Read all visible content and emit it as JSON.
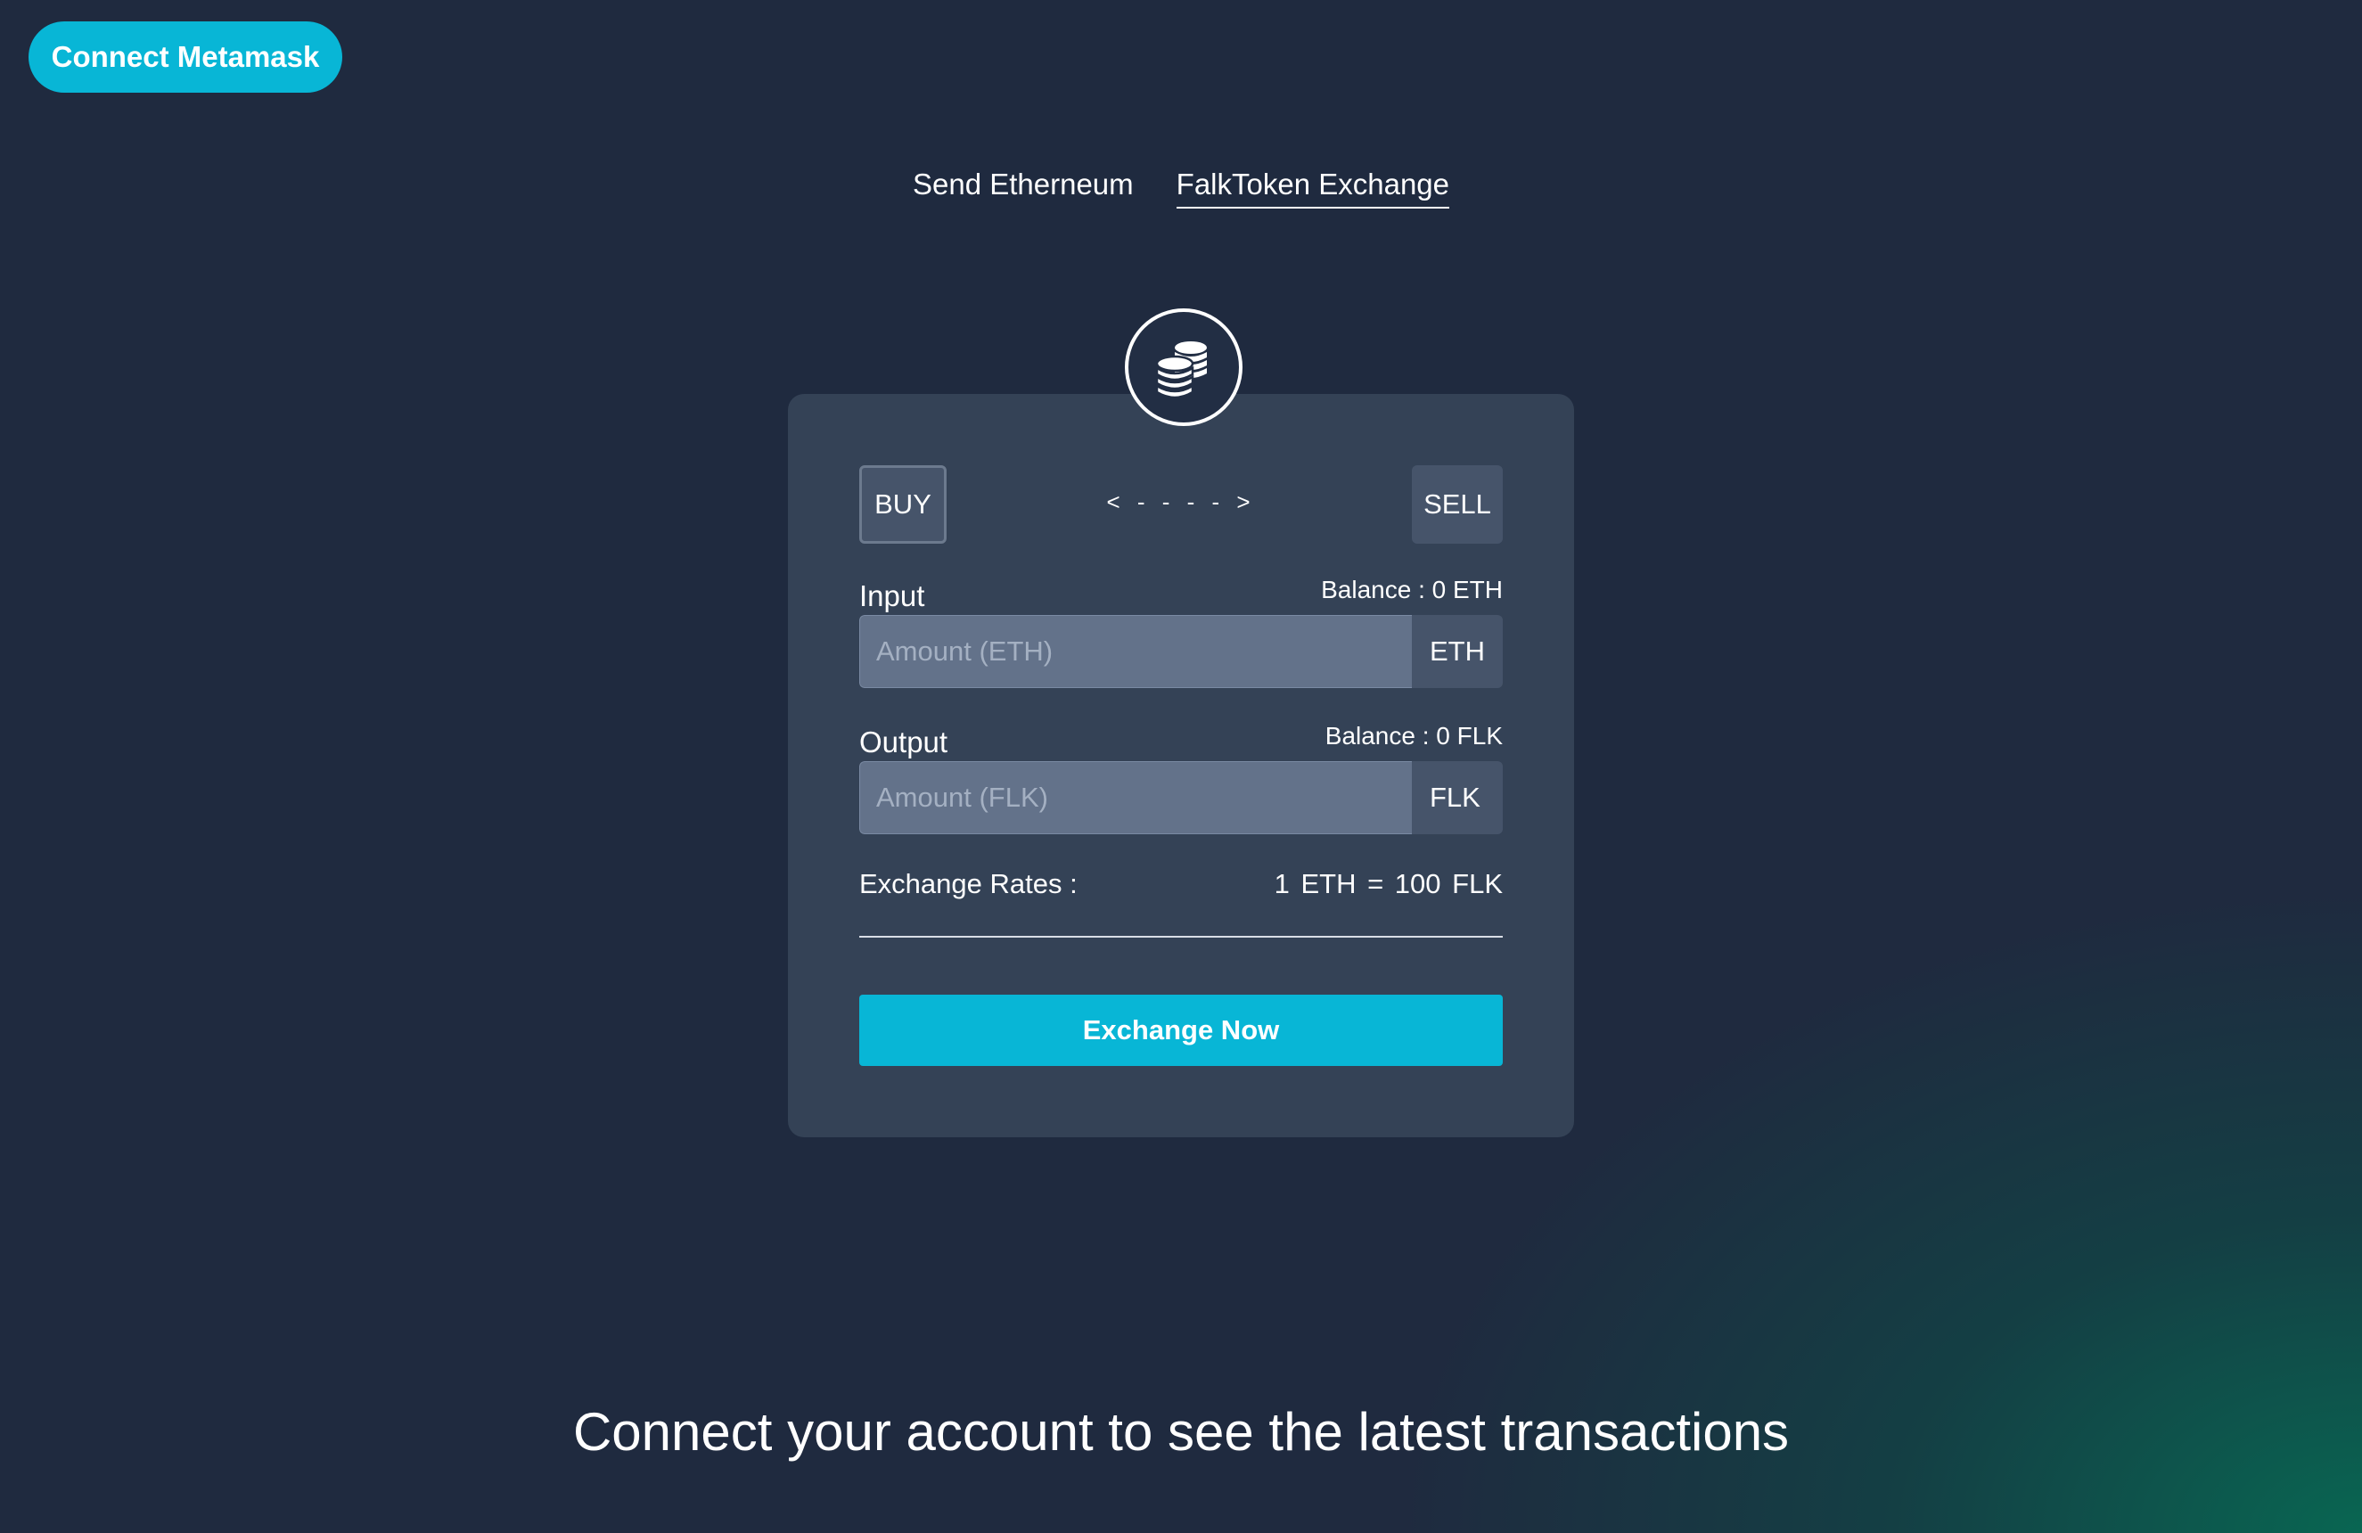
{
  "header": {
    "connect_button_label": "Connect Metamask"
  },
  "nav": {
    "tabs": [
      {
        "label": "Send Etherneum",
        "active": false
      },
      {
        "label": "FalkToken Exchange",
        "active": true
      }
    ]
  },
  "exchange": {
    "icon": "coins-icon",
    "buy_label": "BUY",
    "sell_label": "SELL",
    "direction_text": "< - - - - >",
    "input": {
      "label": "Input",
      "balance": "Balance : 0 ETH",
      "placeholder": "Amount (ETH)",
      "value": "",
      "unit": "ETH"
    },
    "output": {
      "label": "Output",
      "balance": "Balance : 0 FLK",
      "placeholder": "Amount (FLK)",
      "value": "",
      "unit": "FLK"
    },
    "rates_label": "Exchange Rates :",
    "rates_value": "1 ETH = 100 FLK",
    "submit_label": "Exchange Now"
  },
  "footer": {
    "message": "Connect your account to see the latest transactions"
  },
  "colors": {
    "accent": "#08b6d6",
    "background": "#1f2a3f",
    "card": "#344256",
    "gradient_corner": "#096652"
  }
}
